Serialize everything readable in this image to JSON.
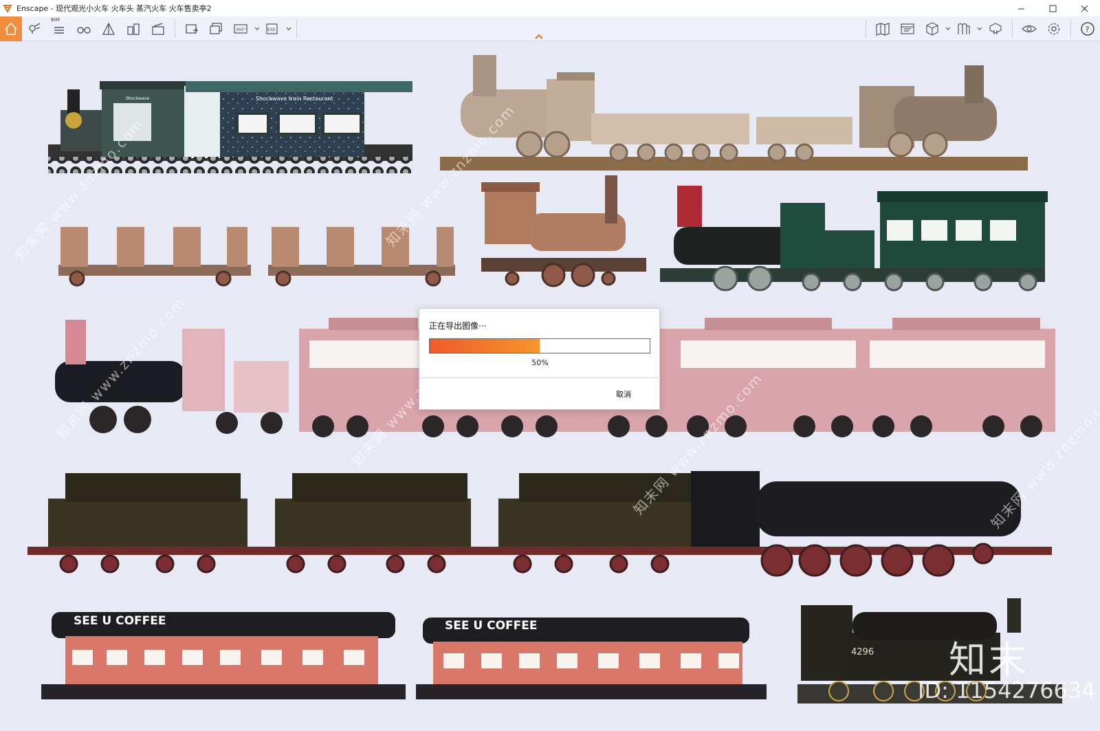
{
  "window": {
    "app_name": "Enscape",
    "title": "Enscape - 现代观光小火车 火车头 蒸汽火车 火车售卖亭2"
  },
  "toolbar": {
    "bim_label": "BIM",
    "left_icons": [
      "home-icon",
      "map-pin-icon",
      "bim-list-icon",
      "binoculars-icon",
      "asset-tent-icon",
      "buildings-icon",
      "clapperboard-icon",
      "screenshot-icon",
      "batch-render-icon",
      "panorama-360-icon",
      "export-exe-icon"
    ],
    "right_icons": [
      "map-icon",
      "atlas-icon",
      "cube-icon",
      "library-icon",
      "collaborate-icon",
      "visual-eye-icon",
      "settings-gear-icon",
      "help-icon"
    ],
    "panorama_label": "360°",
    "exe_label": "EXE"
  },
  "scene": {
    "car_signs": {
      "shockwave": "Shockwave",
      "restaurant": "Shockwave train Restaurant",
      "coffee_1": "SEE U COFFEE",
      "coffee_2": "SEE U COFFEE",
      "loco_number": "4296"
    },
    "watermark": {
      "brand": "知末",
      "id_text": "ID: 1154276634",
      "site": "知末网 www.znzmo.com"
    }
  },
  "export_dialog": {
    "title": "正在导出图像···",
    "progress_percent": 50,
    "progress_text": "50%",
    "cancel_label": "取消",
    "colors": {
      "progress_start": "#ee5a2b",
      "progress_end": "#f7962c"
    }
  },
  "colors": {
    "accent": "#f28c3d",
    "canvas_bg": "#e7eaf4",
    "toolbar_bg": "#eef1fa"
  }
}
